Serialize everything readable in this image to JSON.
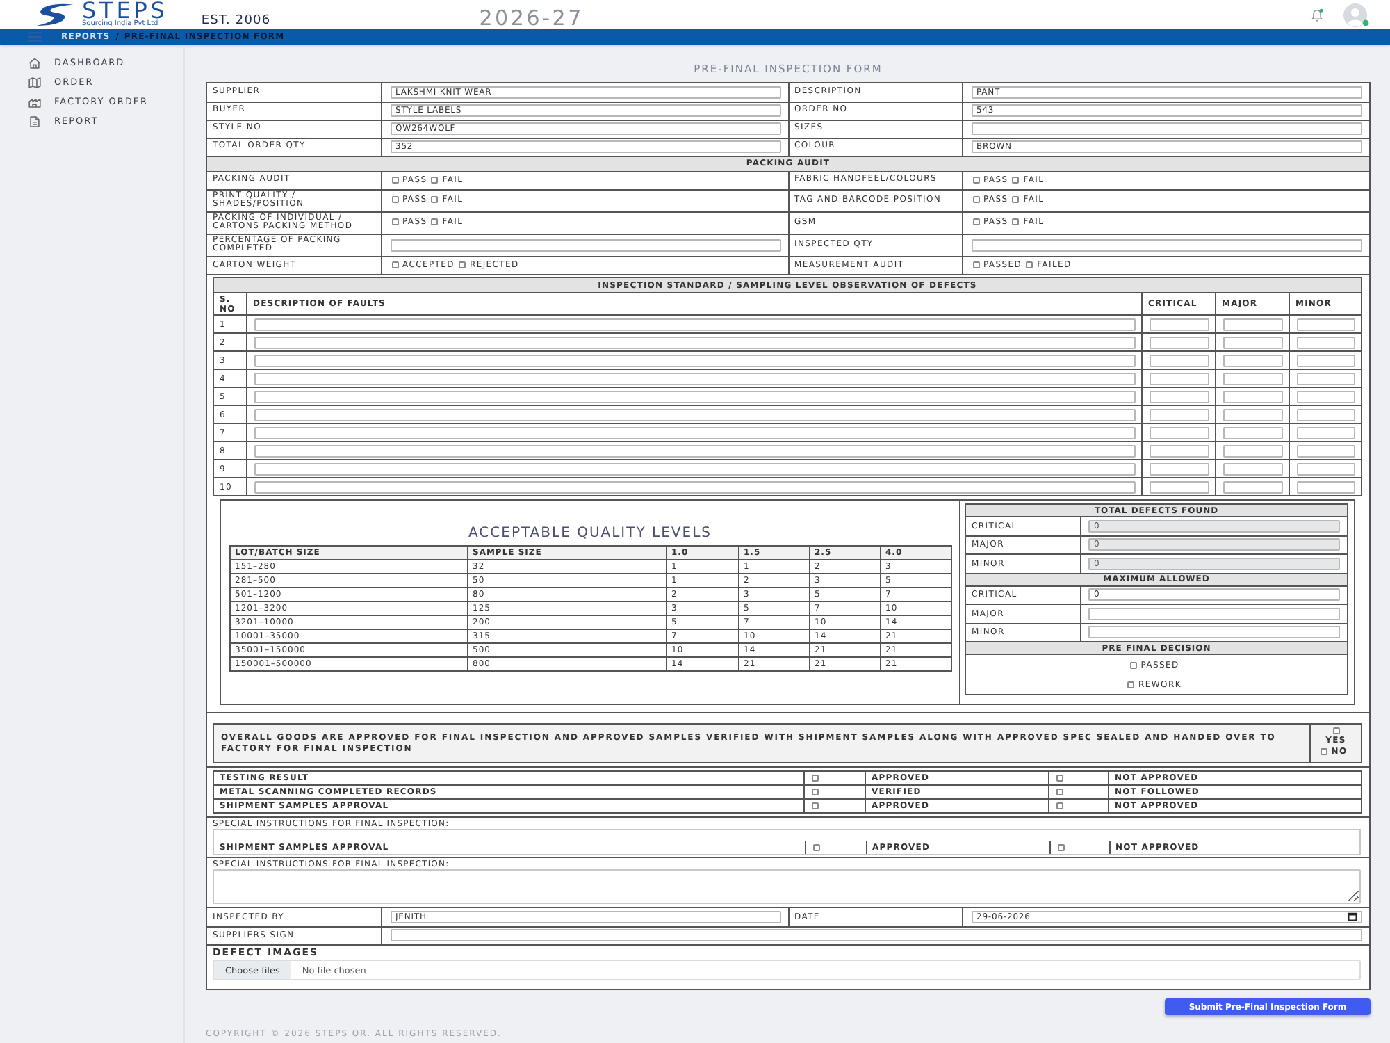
{
  "header": {
    "logo_name": "STEPS",
    "logo_tagline": "Sourcing India Pvt Ltd",
    "established": "EST. 2006",
    "year": "2026-27"
  },
  "nav_bar": {
    "breadcrumb": [
      {
        "label": "REPORTS"
      },
      {
        "label": "PRE-FINAL INSPECTION FORM"
      }
    ],
    "separator": "/"
  },
  "sidebar": {
    "items": [
      {
        "label": "DASHBOARD",
        "selected": false
      },
      {
        "label": "ORDER",
        "selected": false
      },
      {
        "label": "FACTORY ORDER",
        "selected": false
      },
      {
        "label": "REPORT",
        "selected": false
      }
    ]
  },
  "form": {
    "title": "PRE-FINAL INSPECTION FORM",
    "details": [
      {
        "label": "SUPPLIER",
        "value": "LAKSHMI KNIT WEAR"
      },
      {
        "label": "DESCRIPTION",
        "value": "PANT"
      },
      {
        "label": "BUYER",
        "value": "STYLE LABELS"
      },
      {
        "label": "ORDER NO",
        "value": "543"
      },
      {
        "label": "STYLE NO",
        "value": "QW264WOLF"
      },
      {
        "label": "SIZES"
      },
      {
        "label": "TOTAL ORDER QTY",
        "value": "352"
      },
      {
        "label": "COLOUR",
        "value": "BROWN"
      }
    ],
    "packing_audit": {
      "title": "PACKING AUDIT",
      "items": [
        {
          "label": "PACKING AUDIT",
          "kind": "choice",
          "options": [
            {
              "label": "PASS",
              "checked": false
            },
            {
              "label": "FAIL",
              "checked": false
            }
          ]
        },
        {
          "label": "FABRIC HANDFEEL/COLOURS",
          "kind": "choice",
          "options": [
            {
              "label": "PASS",
              "checked": false
            },
            {
              "label": "FAIL",
              "checked": false
            }
          ]
        },
        {
          "label": "PRINT QUALITY / SHADES/POSITION",
          "kind": "choice",
          "options": [
            {
              "label": "PASS",
              "checked": false
            },
            {
              "label": "FAIL",
              "checked": false
            }
          ]
        },
        {
          "label": "TAG AND BARCODE POSITION",
          "kind": "choice",
          "options": [
            {
              "label": "PASS",
              "checked": false
            },
            {
              "label": "FAIL",
              "checked": false
            }
          ]
        },
        {
          "label": "PACKING OF INDIVIDUAL / CARTONS PACKING METHOD",
          "kind": "choice",
          "options": [
            {
              "label": "PASS",
              "checked": false
            },
            {
              "label": "FAIL",
              "checked": false
            }
          ]
        },
        {
          "label": "GSM",
          "kind": "choice",
          "options": [
            {
              "label": "PASS",
              "checked": false
            },
            {
              "label": "FAIL",
              "checked": false
            }
          ]
        },
        {
          "label": "PERCENTAGE OF PACKING COMPLETED",
          "kind": "text"
        },
        {
          "label": "INSPECTED QTY",
          "kind": "text"
        },
        {
          "label": "CARTON WEIGHT",
          "kind": "choice",
          "options": [
            {
              "label": "ACCEPTED",
              "checked": false
            },
            {
              "label": "REJECTED",
              "checked": false
            }
          ]
        },
        {
          "label": "MEASUREMENT AUDIT",
          "kind": "choice",
          "options": [
            {
              "label": "PASSED",
              "checked": false
            },
            {
              "label": "FAILED",
              "checked": false
            }
          ]
        }
      ]
    },
    "defects": {
      "title": "INSPECTION STANDARD / SAMPLING LEVEL OBSERVATION OF DEFECTS",
      "columns": [
        "S. NO",
        "DESCRIPTION OF FAULTS",
        "CRITICAL",
        "MAJOR",
        "MINOR"
      ],
      "rows": [
        "1",
        "2",
        "3",
        "4",
        "5",
        "6",
        "7",
        "8",
        "9",
        "10"
      ]
    },
    "aql": {
      "title": "ACCEPTABLE QUALITY LEVELS",
      "columns": [
        "LOT/BATCH SIZE",
        "SAMPLE SIZE",
        "1.0",
        "1.5",
        "2.5",
        "4.0"
      ],
      "rows": [
        [
          "151–280",
          "32",
          "1",
          "1",
          "2",
          "3"
        ],
        [
          "281–500",
          "50",
          "1",
          "2",
          "3",
          "5"
        ],
        [
          "501–1200",
          "80",
          "2",
          "3",
          "5",
          "7"
        ],
        [
          "1201–3200",
          "125",
          "3",
          "5",
          "7",
          "10"
        ],
        [
          "3201–10000",
          "200",
          "5",
          "7",
          "10",
          "14"
        ],
        [
          "10001–35000",
          "315",
          "7",
          "10",
          "14",
          "21"
        ],
        [
          "35001–150000",
          "500",
          "10",
          "14",
          "21",
          "21"
        ],
        [
          "150001–500000",
          "800",
          "14",
          "21",
          "21",
          "21"
        ]
      ]
    },
    "total_defects": {
      "title": "TOTAL DEFECTS FOUND",
      "rows": [
        {
          "label": "CRITICAL",
          "value": "0",
          "disabled": true
        },
        {
          "label": "MAJOR",
          "value": "0",
          "disabled": true
        },
        {
          "label": "MINOR",
          "value": "0",
          "disabled": true
        }
      ]
    },
    "maximum_allowed": {
      "title": "MAXIMUM ALLOWED",
      "rows": [
        {
          "label": "CRITICAL",
          "value": "0",
          "disabled": false
        },
        {
          "label": "MAJOR",
          "disabled": false
        },
        {
          "label": "MINOR",
          "disabled": false
        }
      ]
    },
    "pre_final_decision": {
      "title": "PRE FINAL DECISION",
      "options": [
        {
          "label": "PASSED",
          "checked": false
        },
        {
          "label": "REWORK",
          "checked": false
        }
      ]
    },
    "overall_approval": {
      "text": "OVERALL GOODS ARE APPROVED FOR FINAL INSPECTION AND APPROVED SAMPLES VERIFIED WITH SHIPMENT SAMPLES ALONG WITH APPROVED SPEC SEALED AND HANDED OVER TO FACTORY FOR FINAL INSPECTION",
      "options": [
        {
          "label": "YES",
          "checked": false
        },
        {
          "label": "NO",
          "checked": false
        }
      ]
    },
    "checks": [
      {
        "label": "TESTING RESULT",
        "options": [
          {
            "label": "APPROVED",
            "checked": false
          },
          {
            "label": "NOT APPROVED",
            "checked": false
          }
        ]
      },
      {
        "label": "METAL SCANNING COMPLETED RECORDS",
        "options": [
          {
            "label": "VERIFIED",
            "checked": false
          },
          {
            "label": "NOT FOLLOWED",
            "checked": false
          }
        ]
      },
      {
        "label": "SHIPMENT SAMPLES APPROVAL",
        "options": [
          {
            "label": "APPROVED",
            "checked": false
          },
          {
            "label": "NOT APPROVED",
            "checked": false
          }
        ]
      }
    ],
    "special_instructions": [
      {
        "label": "SPECIAL INSTRUCTIONS FOR FINAL INSPECTION:",
        "kind": "check_row",
        "check": {
          "label": "SHIPMENT SAMPLES APPROVAL",
          "options": [
            {
              "label": "APPROVED",
              "checked": false
            },
            {
              "label": "NOT APPROVED",
              "checked": false
            }
          ]
        }
      },
      {
        "label": "SPECIAL INSTRUCTIONS FOR FINAL INSPECTION:",
        "kind": "textarea"
      }
    ],
    "sign_off": [
      {
        "label": "INSPECTED BY",
        "kind": "text",
        "value": "JENITH"
      },
      {
        "label": "DATE",
        "kind": "date",
        "value": "29-06-2026"
      },
      {
        "label": "SUPPLIERS SIGN",
        "kind": "text"
      }
    ],
    "defect_images": {
      "label": "DEFECT IMAGES",
      "button": "Choose files",
      "status": "No file chosen"
    },
    "submit_button": "Submit Pre-Final Inspection Form"
  },
  "footer": {
    "copyright": "COPYRIGHT © 2026 STEPS OR. ALL RIGHTS RESERVED."
  }
}
